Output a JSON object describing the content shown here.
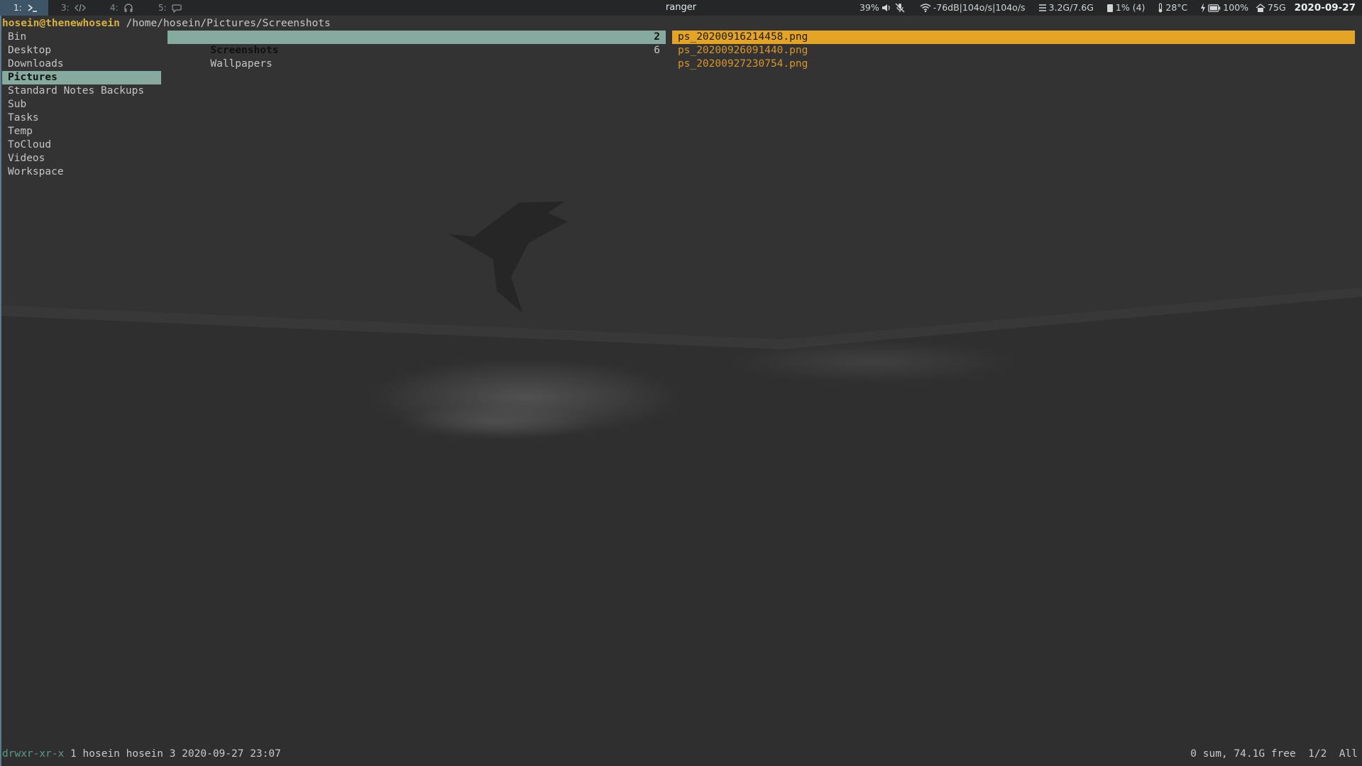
{
  "topbar": {
    "workspaces": [
      {
        "num": "1:",
        "icon": "terminal-icon",
        "active": true
      },
      {
        "num": "3:",
        "icon": "code-icon",
        "active": false
      },
      {
        "num": "4:",
        "icon": "headphones-icon",
        "active": false
      },
      {
        "num": "5:",
        "icon": "chat-bubble-icon",
        "active": false
      }
    ],
    "window_title": "ranger",
    "status": {
      "volume": "39%",
      "volume_icon": "speaker-icon",
      "mic_icon": "mic-muted-icon",
      "wifi": "-76dB|104o/s|104o/s",
      "wifi_icon": "wifi-icon",
      "memory": "3.2G/7.6G",
      "memory_icon": "memory-icon",
      "cpu": "1% (4)",
      "cpu_icon": "cpu-icon",
      "temperature": "28°C",
      "temperature_icon": "thermometer-icon",
      "battery": "100%",
      "battery_icon": "battery-charging-icon",
      "disk": "75G",
      "disk_icon": "home-icon",
      "date": "2020-09-27"
    }
  },
  "ranger": {
    "host": "hosein@thenewhosein",
    "path": "/home/hosein/Pictures/Screenshots",
    "parent_entries": [
      {
        "name": "Bin",
        "selected": false
      },
      {
        "name": "Desktop",
        "selected": false
      },
      {
        "name": "Downloads",
        "selected": false
      },
      {
        "name": "Pictures",
        "selected": true
      },
      {
        "name": "Standard Notes Backups",
        "selected": false
      },
      {
        "name": "Sub",
        "selected": false
      },
      {
        "name": "Tasks",
        "selected": false
      },
      {
        "name": "Temp",
        "selected": false
      },
      {
        "name": "ToCloud",
        "selected": false
      },
      {
        "name": "Videos",
        "selected": false
      },
      {
        "name": "Workspace",
        "selected": false
      }
    ],
    "current_entries": [
      {
        "name": "Screenshots",
        "count": "2",
        "selected": true
      },
      {
        "name": "Wallpapers",
        "count": "6",
        "selected": false
      }
    ],
    "preview_entries": [
      {
        "name": "ps_20200916214458.png",
        "selected": true
      },
      {
        "name": "ps_20200926091440.png",
        "selected": false
      },
      {
        "name": "ps_20200927230754.png",
        "selected": false
      }
    ],
    "statusbar": {
      "permissions": "drwxr-xr-x",
      "meta": " 1 hosein hosein 3 2020-09-27 23:07",
      "summary": "0 sum, 74.1G free  1/2  All"
    }
  },
  "colors": {
    "background": "#323232",
    "topbar": "#252627",
    "selection": "#86aa9f",
    "file_highlight": "#e4a426",
    "file_text": "#d9952a",
    "host": "#d9b13e"
  }
}
